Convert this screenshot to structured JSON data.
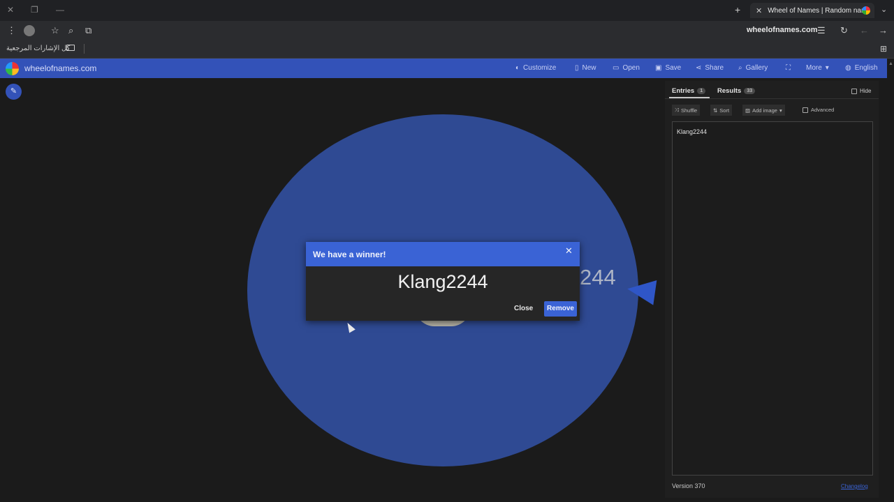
{
  "browser": {
    "tab_title": "Wheel of Names | Random nam",
    "tab_close_icon": "close-icon",
    "url": "wheelofnames.com",
    "bookmarks_label": "كل الإشارات المرجعية"
  },
  "site": {
    "name": "wheelofnames.com",
    "nav": {
      "customize": "Customize",
      "new": "New",
      "open": "Open",
      "save": "Save",
      "share": "Share",
      "gallery": "Gallery",
      "more": "More",
      "language": "English"
    },
    "accent_color": "#3352b8"
  },
  "wheel": {
    "slice_label": "244",
    "color": "#2f4a93"
  },
  "dialog": {
    "title": "We have a winner!",
    "winner": "Klang2244",
    "close_label": "Close",
    "remove_label": "Remove"
  },
  "sidebar": {
    "tabs": [
      {
        "label": "Entries",
        "count": "1"
      },
      {
        "label": "Results",
        "count": "33"
      }
    ],
    "hide_label": "Hide",
    "buttons": {
      "shuffle": "Shuffle",
      "sort": "Sort",
      "add_image": "Add image"
    },
    "advanced_label": "Advanced",
    "entries_text": "Klang2244",
    "version": "Version 370",
    "changelog": "Changelog"
  }
}
